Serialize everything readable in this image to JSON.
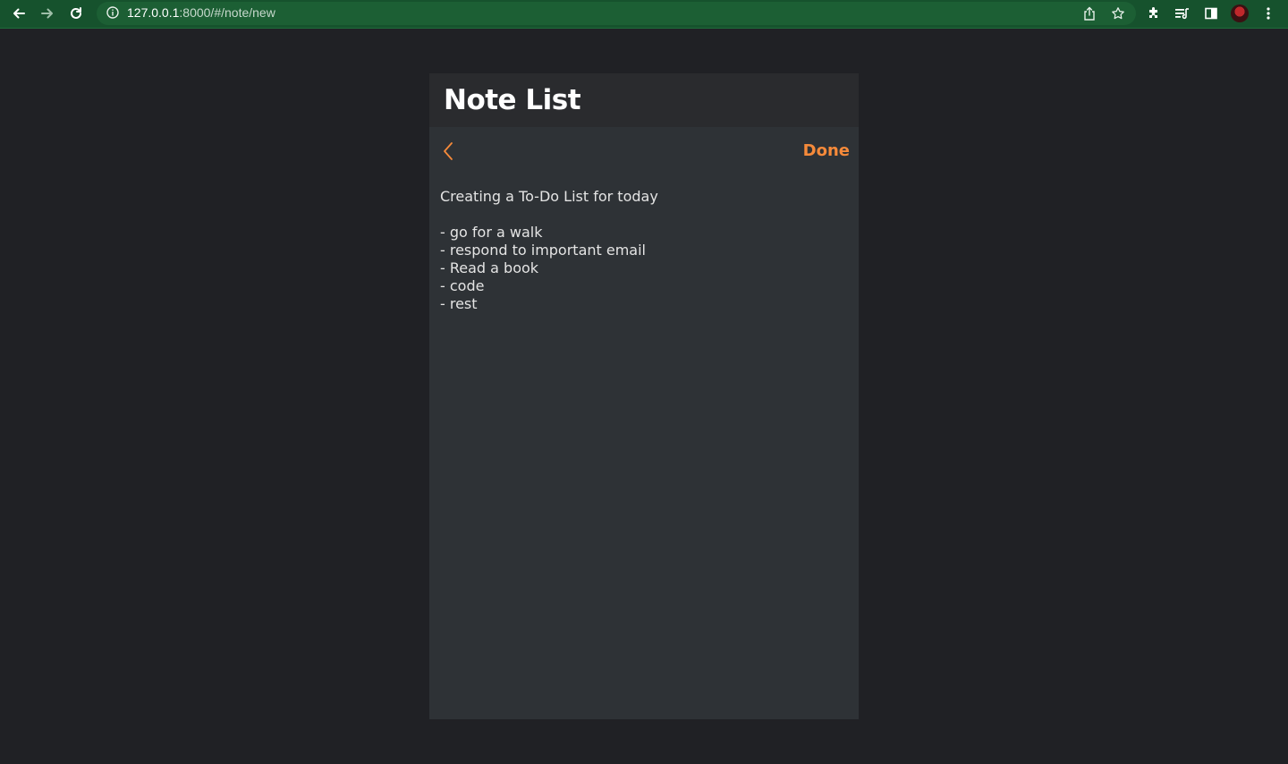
{
  "browser": {
    "url_host": "127.0.0.1",
    "url_rest": ":8000/#/note/new"
  },
  "app": {
    "title": "Note List",
    "done_label": "Done",
    "accent_color": "#f68a3a"
  },
  "note": {
    "content": "Creating a To-Do List for today\n\n- go for a walk\n- respond to important email\n- Read a book\n- code\n- rest"
  }
}
